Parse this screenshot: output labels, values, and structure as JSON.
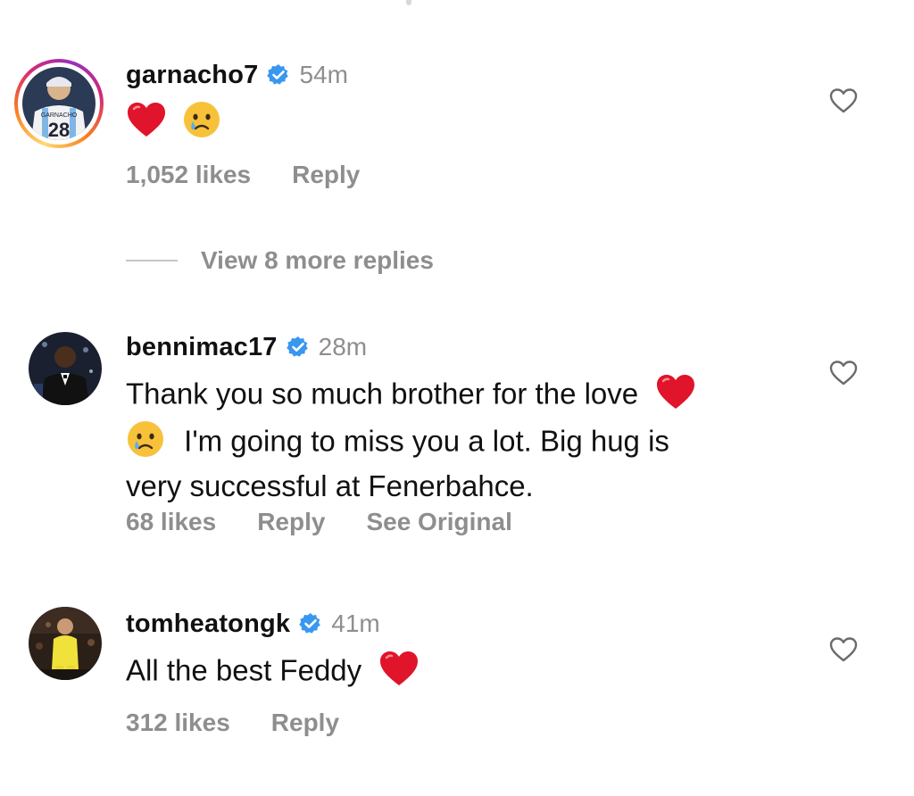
{
  "comments": [
    {
      "username": "garnacho7",
      "time": "54m",
      "text": "",
      "likes": "1,052 likes",
      "reply": "Reply"
    },
    {
      "username": "bennimac17",
      "time": "28m",
      "text_line1": "Thank you so much brother for the love",
      "text_line2": "I'm going to miss you a lot. Big hug is",
      "text_line3": "very successful at Fenerbahce.",
      "likes": "68 likes",
      "reply": "Reply",
      "see_original": "See Original"
    },
    {
      "username": "tomheatongk",
      "time": "41m",
      "text": "All the best Feddy",
      "likes": "312 likes",
      "reply": "Reply"
    }
  ],
  "view_more_replies": "View 8 more replies",
  "colors": {
    "verified": "#3897f0",
    "heart_emoji": "#e0142a",
    "muted_text": "#8e8e8e"
  },
  "icons": [
    "verified-badge-icon",
    "heart-outline-icon",
    "red-heart-emoji",
    "crying-face-emoji"
  ]
}
